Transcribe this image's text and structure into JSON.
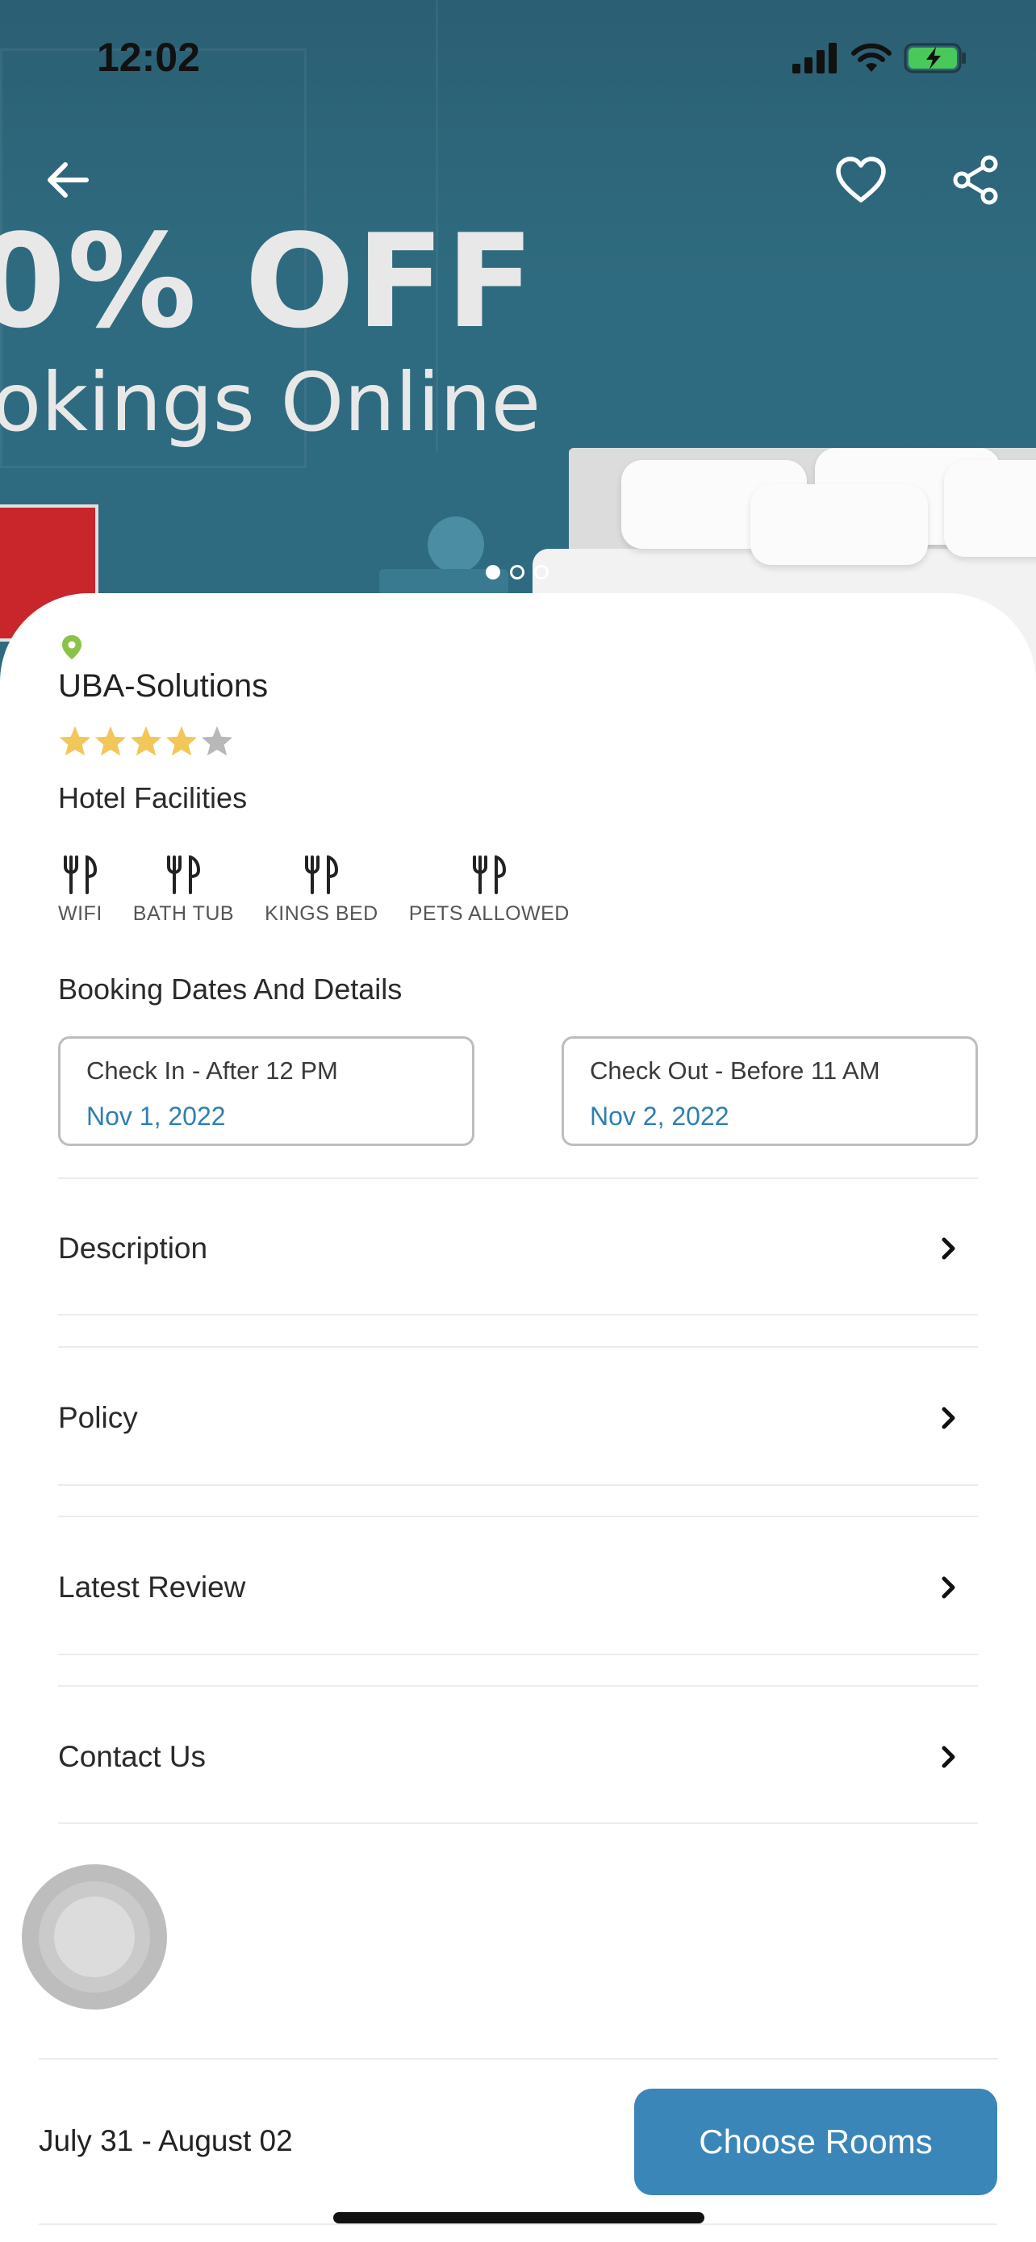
{
  "status_bar": {
    "time": "12:02"
  },
  "hero": {
    "promo_line1": "0% OFF",
    "promo_line2": "okings Online",
    "carousel": {
      "count": 3,
      "active_index": 0
    }
  },
  "hotel": {
    "name": "UBA-Solutions",
    "rating": 4,
    "rating_max": 5,
    "facilities_title": "Hotel Facilities",
    "facilities": [
      {
        "label": "WIFI",
        "icon": "fork-knife-icon"
      },
      {
        "label": "BATH TUB",
        "icon": "fork-knife-icon"
      },
      {
        "label": "KINGS BED",
        "icon": "fork-knife-icon"
      },
      {
        "label": "PETS ALLOWED",
        "icon": "fork-knife-icon"
      }
    ]
  },
  "booking": {
    "title": "Booking Dates And Details",
    "check_in": {
      "label": "Check In - After 12 PM",
      "date": "Nov 1, 2022"
    },
    "check_out": {
      "label": "Check Out - Before 11 AM",
      "date": "Nov 2, 2022"
    }
  },
  "sections": [
    {
      "label": "Description"
    },
    {
      "label": "Policy"
    },
    {
      "label": "Latest Review"
    },
    {
      "label": "Contact Us"
    }
  ],
  "footer": {
    "date_range": "July 31 - August 02",
    "cta_label": "Choose Rooms"
  },
  "colors": {
    "accent": "#3b86b8",
    "date_text": "#2f7fb0",
    "star_filled": "#f1c75a",
    "star_empty": "#b8b8b8",
    "pin": "#8bc34a"
  }
}
